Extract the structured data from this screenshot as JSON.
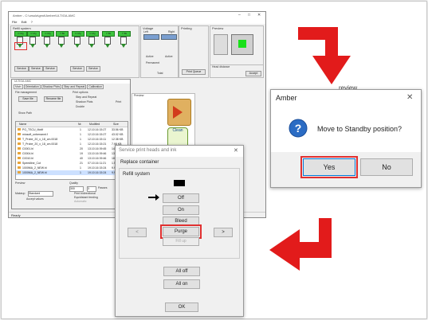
{
  "main_window": {
    "title": "Amber - C:\\ursula\\gmd\\Amber\\ULTIGA.AMC",
    "menu": [
      "File",
      "Edit",
      "?"
    ],
    "refill_label": "Refill system",
    "ink_caps": [
      "C Mg",
      "C Mg",
      "C Mg",
      "Y Bk",
      "K Mg",
      "C Mg",
      "Y Bk",
      "Y Bk"
    ],
    "service_buttons": [
      "Service",
      "Service",
      "Service",
      "Service",
      "Service"
    ],
    "voltage": {
      "label": "Voltage",
      "left": "Left",
      "right": "Right",
      "active1": "Active",
      "active2": "Active",
      "permanent": "Permanent",
      "total": "Total"
    },
    "printing_label": "Printing",
    "print_queue": "Print Queue",
    "preview_label": "Preview",
    "head_label": "Head distance",
    "accept": "Accept",
    "status": "Ready"
  },
  "file_panel": {
    "title": "ULTIGA.AMC",
    "tabs": [
      "Main",
      "Orientation",
      "Shadow Plots",
      "Step and Repeat",
      "Calibration"
    ],
    "file_management": "File management",
    "save_file": "Save file",
    "rename_file": "Rename file",
    "show_path": "Show Path",
    "print_options": "Print options",
    "opt_step": "Step and Repeat",
    "opt_shadow": "Shadow Plots",
    "opt_double": "Double",
    "print": "Print",
    "columns": [
      "Name",
      "Nr.",
      "Modified",
      "Size"
    ],
    "files": [
      [
        "PG_TSCU_Motif",
        "1",
        "12.10.16 15:27",
        "33.56 KB"
      ],
      [
        "miosoft_unbenannt.f",
        "1",
        "12.10.16 15:27",
        "43.02 KB"
      ],
      [
        "T_Probe_20_x_18_cm.0018",
        "1",
        "12.10.16 15:11",
        "12.38 KB"
      ],
      [
        "T_Probe_20_x_18_cm.0018",
        "1",
        "12.10.16 15:21",
        "7.98 KB"
      ],
      [
        "C0001.hl",
        "20",
        "13.10.16 09:45",
        "14.13 KB"
      ],
      [
        "C0004.hl",
        "19",
        "13.10.16 09:46",
        "13.84 KB"
      ],
      [
        "C0010.hl",
        "40",
        "13.10.16 09:46",
        "18.91 KB"
      ],
      [
        "Speedline_Cut",
        "21",
        "07.10.16 11:21",
        "1.54 KB"
      ],
      [
        "1000MA_2_NEW.hl",
        "1",
        "19.10.16 15:24",
        "9.98 KB"
      ],
      [
        "1000MA_2_NEW.hl",
        "1",
        "19.10.16 15:24",
        "9.98 KB"
      ]
    ],
    "preview_label": "Preview",
    "quality": "Quality",
    "quality_value": "300",
    "quality_passes": "Passes",
    "passes_value": "3",
    "mode_label": "Makeup",
    "mode_value": "Standard",
    "accept_values": "Accept values",
    "opt_bidirectional": "Print bidirectional",
    "opt_equidistant": "Equidistant feeding",
    "opt_automatic": "Automatic",
    "preview_badge": "Clean"
  },
  "service_dialog": {
    "title": "Service print heads and ink",
    "subtitle": "Replace container",
    "group": "Refill system",
    "btn_off": "Off",
    "btn_on": "On",
    "btn_bleed": "Bleed",
    "btn_purge": "Purge",
    "btn_fillup": "Fill up",
    "nav_left": "<",
    "nav_right": ">",
    "btn_all_off": "All off",
    "btn_all_on": "All on",
    "btn_ok": "OK",
    "close": "✕"
  },
  "amber_dialog": {
    "title": "Amber",
    "message": "Move to Standby position?",
    "yes": "Yes",
    "no": "No",
    "close": "✕",
    "behind_text": "review"
  },
  "colors": {
    "arrow": "#e21b1b",
    "highlight": "#e03030",
    "ink_cap": "#3cc43c",
    "preview_green": "#19e019"
  }
}
